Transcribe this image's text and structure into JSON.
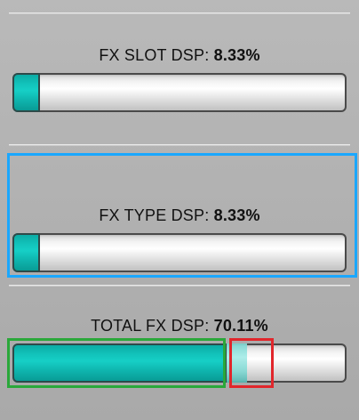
{
  "fx_slot_dsp": {
    "label": "FX SLOT DSP:",
    "value_text": "8.33%",
    "value_percent": 8.33
  },
  "fx_type_dsp": {
    "label": "FX TYPE DSP:",
    "value_text": "8.33%",
    "value_percent": 8.33
  },
  "total_fx_dsp": {
    "label": "TOTAL FX DSP:",
    "value_text": "70.11%",
    "value_percent": 70.11,
    "committed_percent": 64.0,
    "pending_percent": 6.11
  },
  "colors": {
    "meter_fill": "#12c3bb",
    "pending_fill": "#a8ece8",
    "highlight_blue": "#1aa7ff",
    "highlight_green": "#2aa83a",
    "highlight_red": "#e1262b"
  }
}
